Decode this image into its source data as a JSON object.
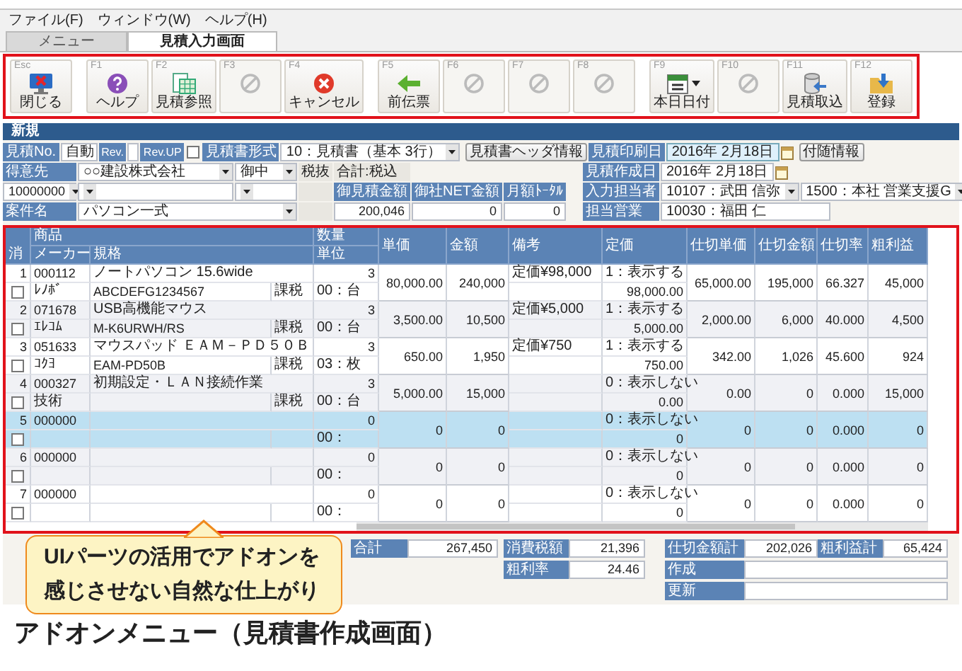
{
  "menu": [
    "ファイル(F)",
    "ウィンドウ(W)",
    "ヘルプ(H)"
  ],
  "tabs": [
    {
      "label": "メニュー",
      "selected": false
    },
    {
      "label": "見積入力画面",
      "selected": true
    }
  ],
  "toolbar": {
    "groups": [
      [
        {
          "key": "Esc",
          "label": "閉じる",
          "kind": "close",
          "disabled": false,
          "dropdown": false
        }
      ],
      [
        {
          "key": "F1",
          "label": "ヘルプ",
          "kind": "help",
          "disabled": false,
          "dropdown": false
        },
        {
          "key": "F2",
          "label": "見積参照",
          "kind": "browse",
          "disabled": false,
          "dropdown": false
        },
        {
          "key": "F3",
          "kind": "blank",
          "disabled": true,
          "dropdown": false
        },
        {
          "key": "F4",
          "label": "キャンセル",
          "kind": "cancel",
          "disabled": false,
          "dropdown": false
        }
      ],
      [
        {
          "key": "F5",
          "label": "前伝票",
          "kind": "back",
          "disabled": false,
          "dropdown": false
        },
        {
          "key": "F6",
          "kind": "blank",
          "disabled": true,
          "dropdown": false
        },
        {
          "key": "F7",
          "kind": "blank",
          "disabled": true,
          "dropdown": false
        },
        {
          "key": "F8",
          "kind": "blank",
          "disabled": true,
          "dropdown": false
        }
      ],
      [
        {
          "key": "F9",
          "label": "本日日付",
          "kind": "calendar",
          "disabled": false,
          "dropdown": true
        },
        {
          "key": "F10",
          "kind": "blank",
          "disabled": true,
          "dropdown": false
        },
        {
          "key": "F11",
          "label": "見積取込",
          "kind": "import",
          "disabled": false,
          "dropdown": false
        },
        {
          "key": "F12",
          "label": "登録",
          "kind": "save",
          "disabled": false,
          "dropdown": false
        }
      ]
    ]
  },
  "section": {
    "title": "新規"
  },
  "form": {
    "estimate_no": {
      "label": "見積No.",
      "value": "自動"
    },
    "rev": {
      "label": "Rev."
    },
    "rev_up": {
      "label": "Rev.UP",
      "checked": false
    },
    "format": {
      "label": "見積書形式",
      "value": "10：見積書（基本 3行）"
    },
    "header_button": "見積書ヘッダ情報",
    "customer": {
      "label": "得意先",
      "value": "○○建設株式会社",
      "honorific": "御中",
      "code": "10000000"
    },
    "tax_mode": "税抜",
    "total_mode": "合計:税込",
    "summary": [
      {
        "label": "御見積金額",
        "value": "200,046"
      },
      {
        "label": "御社NET金額",
        "value": "0"
      },
      {
        "label": "月額ﾄｰﾀﾙ",
        "value": "0"
      }
    ],
    "project": {
      "label": "案件名",
      "value": "パソコン一式"
    },
    "print_date": {
      "label": "見積印刷日",
      "value": "2016年 2月18日"
    },
    "attach_button": "付随情報",
    "created_date": {
      "label": "見積作成日",
      "value": "2016年 2月18日"
    },
    "staff": {
      "label": "入力担当者",
      "value": "10107：武田 信弥",
      "dept": "1500：本社 営業支援G"
    },
    "sales": {
      "label": "担当営業",
      "value": "10030：福田 仁"
    }
  },
  "grid": {
    "header": {
      "product": "商品",
      "quantity": "数量",
      "delete": "消",
      "maker": "メーカー",
      "spec": "規格",
      "unit": "単位",
      "columns": [
        "単価",
        "金額",
        "備考",
        "定価",
        "仕切単価",
        "仕切金額",
        "仕切率",
        "粗利益"
      ]
    },
    "rows": [
      {
        "no": "1",
        "code": "000112",
        "name": "ノートパソコン 15.6wide",
        "qty": "3",
        "maker": "ﾚﾉﾎﾞ",
        "spec": "ABCDEFG1234567",
        "tax": "課税",
        "unit": "00：台",
        "price": "80,000.00",
        "amount": "240,000",
        "note": "定価¥98,000",
        "lp_mode": "1：表示する",
        "lp": "98,000.00",
        "cost_price": "65,000.00",
        "cost_amount": "195,000",
        "cost_rate": "66.327",
        "profit": "45,000",
        "checked": false,
        "selected": false
      },
      {
        "no": "2",
        "code": "071678",
        "name": "USB高機能マウス",
        "qty": "3",
        "maker": "ｴﾚｺﾑ",
        "spec": "M-K6URWH/RS",
        "tax": "課税",
        "unit": "00：台",
        "price": "3,500.00",
        "amount": "10,500",
        "note": "定価¥5,000",
        "lp_mode": "1：表示する",
        "lp": "5,000.00",
        "cost_price": "2,000.00",
        "cost_amount": "6,000",
        "cost_rate": "40.000",
        "profit": "4,500",
        "checked": false,
        "selected": false
      },
      {
        "no": "3",
        "code": "051633",
        "name": "マウスパッド ＥＡＭ－ＰＤ５０Ｂ",
        "qty": "3",
        "maker": "ｺｸﾖ",
        "spec": "EAM-PD50B",
        "tax": "課税",
        "unit": "03：枚",
        "price": "650.00",
        "amount": "1,950",
        "note": "定価¥750",
        "lp_mode": "1：表示する",
        "lp": "750.00",
        "cost_price": "342.00",
        "cost_amount": "1,026",
        "cost_rate": "45.600",
        "profit": "924",
        "checked": false,
        "selected": false
      },
      {
        "no": "4",
        "code": "000327",
        "name": "初期設定・ＬＡＮ接続作業",
        "qty": "3",
        "maker": "技術",
        "tax": "課税",
        "unit": "00：台",
        "price": "5,000.00",
        "amount": "15,000",
        "lp_mode": "0：表示しない",
        "lp": "0.00",
        "cost_price": "0.00",
        "cost_amount": "0",
        "cost_rate": "0.000",
        "profit": "15,000",
        "checked": false,
        "selected": false
      },
      {
        "no": "5",
        "code": "000000",
        "qty": "0",
        "unit": "00：",
        "price": "0",
        "amount": "0",
        "lp_mode": "0：表示しない",
        "lp": "0",
        "cost_price": "0",
        "cost_amount": "0",
        "cost_rate": "0.000",
        "profit": "0",
        "checked": false,
        "selected": true
      },
      {
        "no": "6",
        "code": "000000",
        "qty": "0",
        "unit": "00：",
        "price": "0",
        "amount": "0",
        "lp_mode": "0：表示しない",
        "lp": "0",
        "cost_price": "0",
        "cost_amount": "0",
        "cost_rate": "0.000",
        "profit": "0",
        "checked": false,
        "selected": false
      },
      {
        "no": "7",
        "code": "000000",
        "qty": "0",
        "unit": "00：",
        "price": "0",
        "amount": "0",
        "lp_mode": "0：表示しない",
        "lp": "0",
        "cost_price": "0",
        "cost_amount": "0",
        "cost_rate": "0.000",
        "profit": "0",
        "checked": false,
        "selected": false
      }
    ]
  },
  "totals": {
    "total": {
      "label": "合計",
      "value": "267,450"
    },
    "tax": {
      "label": "消費税額",
      "value": "21,396"
    },
    "margin_rate": {
      "label": "粗利率",
      "value": "24.46"
    },
    "cost_total": {
      "label": "仕切金額計",
      "value": "202,026"
    },
    "profit_total": {
      "label": "粗利益計",
      "value": "65,424"
    },
    "created": {
      "label": "作成"
    },
    "updated": {
      "label": "更新"
    }
  },
  "callout": [
    "UIパーツの活用でアドオンを",
    "感じさせない自然な仕上がり"
  ],
  "caption": "アドオンメニュー（見積書作成画面）"
}
